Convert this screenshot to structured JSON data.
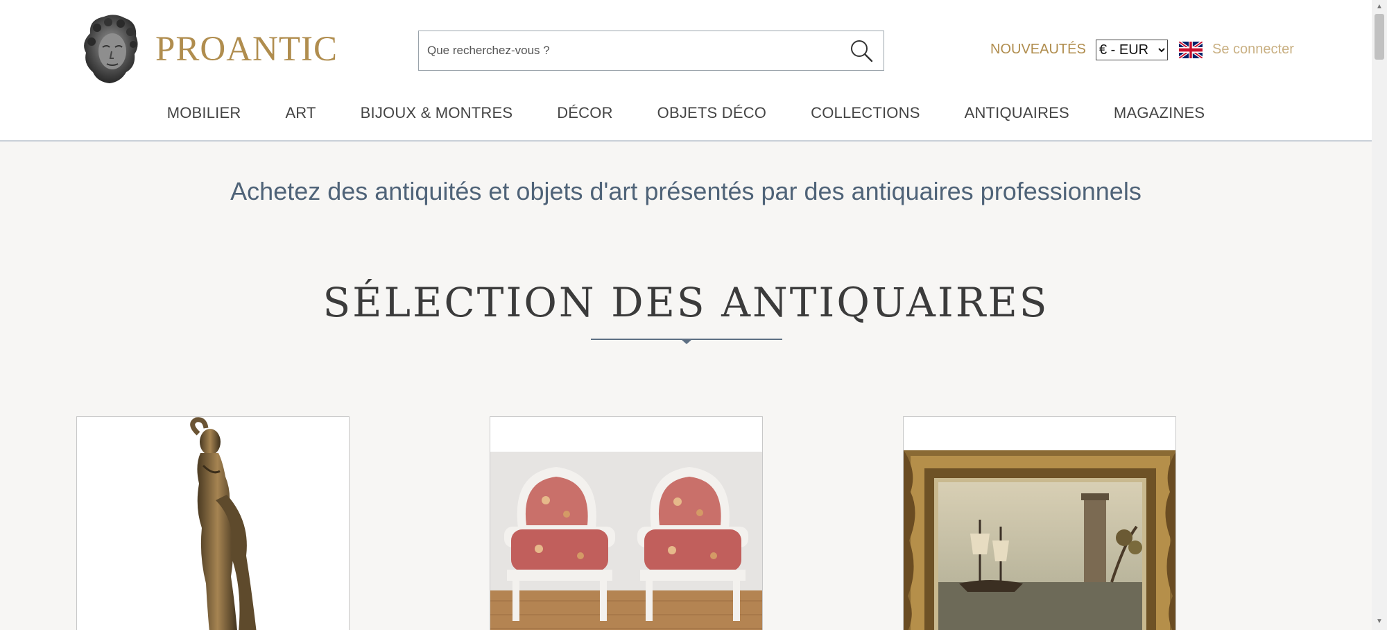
{
  "header": {
    "logo_text": "PROANTIC",
    "search": {
      "placeholder": "Que recherchez-vous ?"
    },
    "nouveautes_label": "NOUVEAUTÉS",
    "currency_selected": "€ - EUR",
    "login_label": "Se connecter",
    "language_flag": "uk-flag-icon"
  },
  "nav": {
    "items": [
      {
        "label": "MOBILIER"
      },
      {
        "label": "ART"
      },
      {
        "label": "BIJOUX & MONTRES"
      },
      {
        "label": "DÉCOR"
      },
      {
        "label": "OBJETS DÉCO"
      },
      {
        "label": "COLLECTIONS"
      },
      {
        "label": "ANTIQUAIRES"
      },
      {
        "label": "MAGAZINES"
      }
    ]
  },
  "main": {
    "tagline": "Achetez des antiquités et objets d'art présentés par des antiquaires professionnels",
    "section_title": "SÉLECTION DES ANTIQUAIRES",
    "cards": [
      {
        "image": "bronze-statue-image"
      },
      {
        "image": "pair-of-armchairs-image"
      },
      {
        "image": "framed-marine-painting-image"
      }
    ]
  },
  "colors": {
    "brand_gold": "#b08d4e",
    "login_gold": "#c9b083",
    "tagline_blue": "#4f6378",
    "background": "#f7f6f4"
  }
}
